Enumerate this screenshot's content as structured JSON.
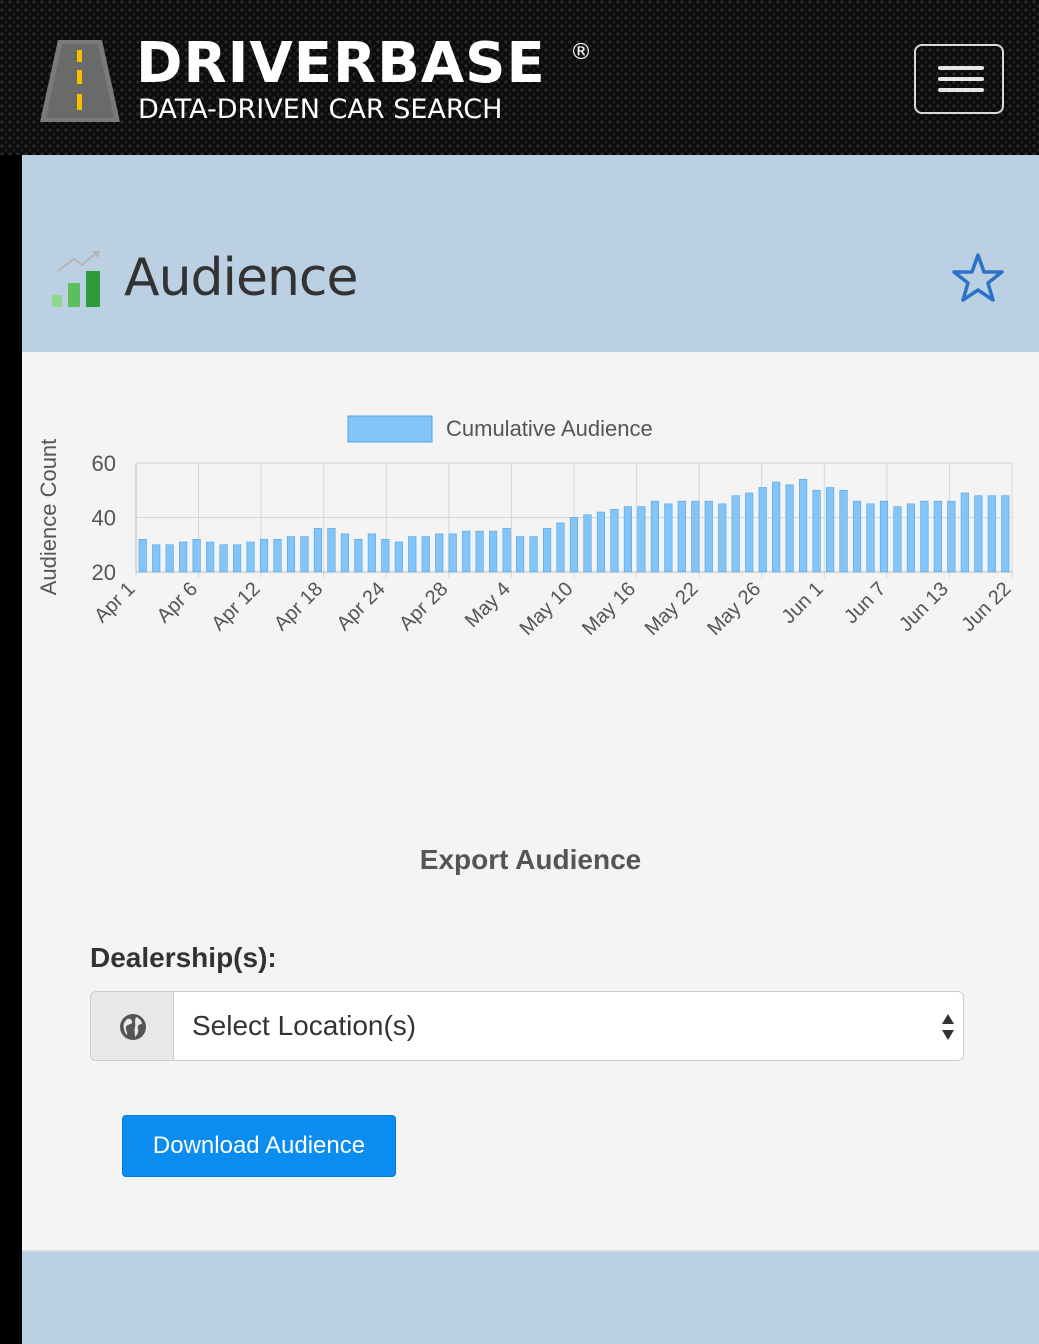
{
  "header": {
    "brand": "DRIVERBASE",
    "registered_mark": "®",
    "tagline": "DATA-DRIVEN CAR SEARCH",
    "menu_icon": "hamburger-icon"
  },
  "section": {
    "title": "Audience",
    "icon": "bar-chart-trend-icon",
    "favorite_icon": "star-outline-icon"
  },
  "chart_data": {
    "type": "bar",
    "legend": [
      "Cumulative Audience"
    ],
    "legend_placement": "top-center",
    "ylabel": "Audience Count",
    "ylim": [
      20,
      60
    ],
    "yticks": [
      20,
      40,
      60
    ],
    "grid": true,
    "bar_color": "#84c4f6",
    "xtick_labels": [
      "Apr 1",
      "Apr 6",
      "Apr 12",
      "Apr 18",
      "Apr 24",
      "Apr 28",
      "May 4",
      "May 10",
      "May 16",
      "May 22",
      "May 26",
      "Jun 1",
      "Jun 7",
      "Jun 13",
      "Jun 22"
    ],
    "series": [
      {
        "name": "Cumulative Audience",
        "values": [
          32,
          30,
          30,
          31,
          32,
          31,
          30,
          30,
          31,
          32,
          32,
          33,
          33,
          36,
          36,
          34,
          32,
          34,
          32,
          31,
          33,
          33,
          34,
          34,
          35,
          35,
          35,
          36,
          33,
          33,
          36,
          38,
          40,
          41,
          42,
          43,
          44,
          44,
          46,
          45,
          46,
          46,
          46,
          45,
          48,
          49,
          51,
          53,
          52,
          54,
          50,
          51,
          50,
          46,
          45,
          46,
          44,
          45,
          46,
          46,
          46,
          49,
          48,
          48,
          48
        ]
      }
    ]
  },
  "export": {
    "title": "Export Audience",
    "dealership_label": "Dealership(s):",
    "location_icon": "globe-icon",
    "select_value": "Select Location(s)",
    "download_label": "Download Audience"
  }
}
